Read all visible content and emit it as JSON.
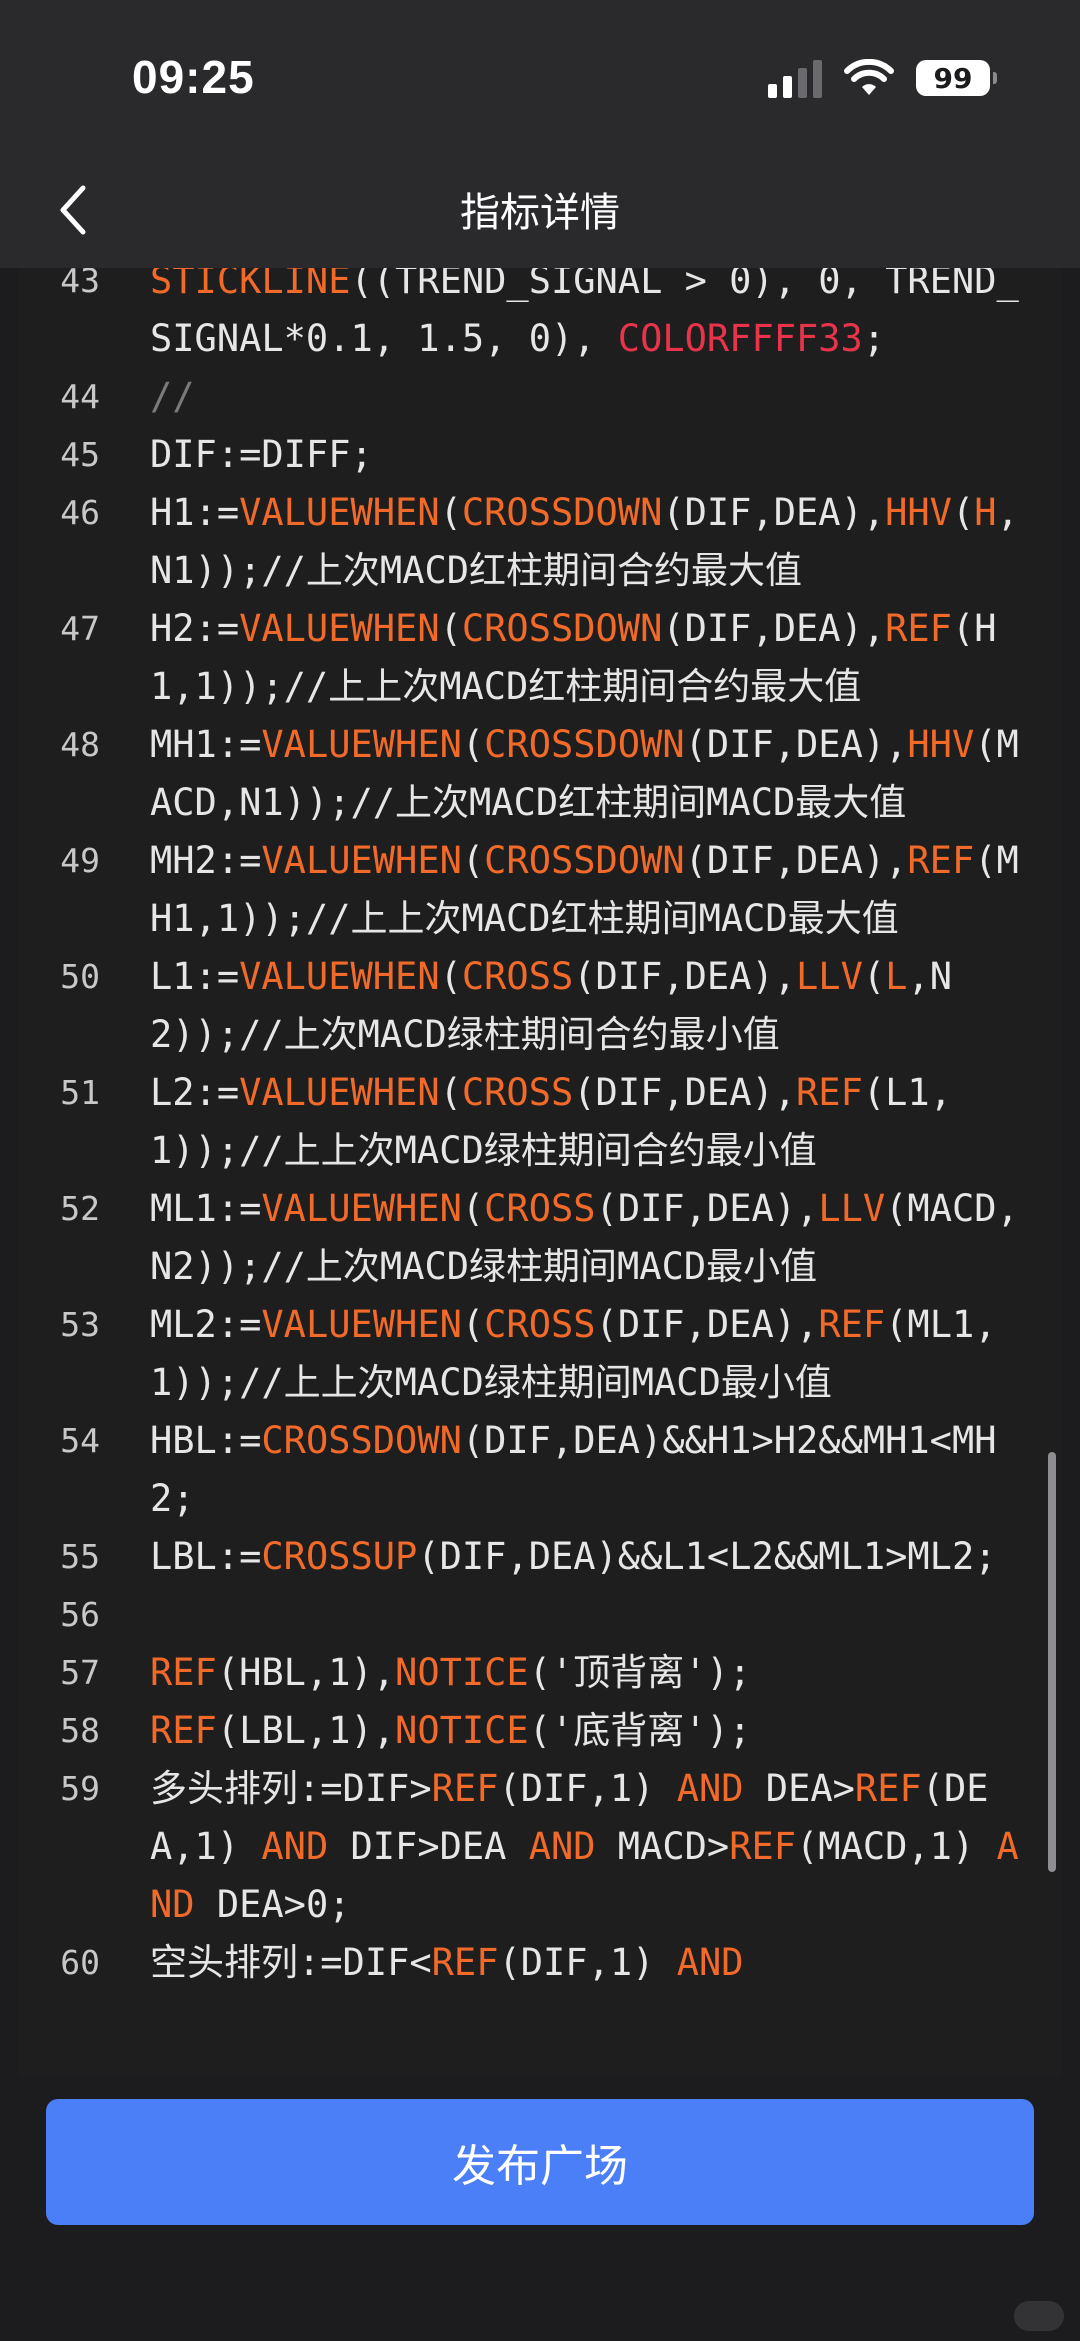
{
  "status_bar": {
    "time": "09:25",
    "battery": "99",
    "icons": [
      "signal-icon",
      "wifi-icon",
      "battery-icon"
    ]
  },
  "nav": {
    "title": "指标详情",
    "back_icon": "chevron-left-icon"
  },
  "code_lines": [
    {
      "number": "43",
      "tokens": [
        {
          "t": "fn",
          "v": "STICKLINE"
        },
        {
          "t": "plain",
          "v": "((TREND_SIGNAL > 0), 0, TREND_SIGNAL*0.1, 1.5, 0), "
        },
        {
          "t": "color",
          "v": "COLORFFFF33"
        },
        {
          "t": "plain",
          "v": ";"
        }
      ]
    },
    {
      "number": "44",
      "tokens": [
        {
          "t": "comment",
          "v": "//"
        }
      ]
    },
    {
      "number": "45",
      "tokens": [
        {
          "t": "plain",
          "v": "DIF:=DIFF;"
        }
      ]
    },
    {
      "number": "46",
      "tokens": [
        {
          "t": "plain",
          "v": "H1:="
        },
        {
          "t": "fn",
          "v": "VALUEWHEN"
        },
        {
          "t": "plain",
          "v": "("
        },
        {
          "t": "fn",
          "v": "CROSSDOWN"
        },
        {
          "t": "plain",
          "v": "(DIF,DEA),"
        },
        {
          "t": "fn",
          "v": "HHV"
        },
        {
          "t": "plain",
          "v": "("
        },
        {
          "t": "fn",
          "v": "H"
        },
        {
          "t": "plain",
          "v": ",N1));//上次MACD红柱期间合约最大值"
        }
      ]
    },
    {
      "number": "47",
      "tokens": [
        {
          "t": "plain",
          "v": "H2:="
        },
        {
          "t": "fn",
          "v": "VALUEWHEN"
        },
        {
          "t": "plain",
          "v": "("
        },
        {
          "t": "fn",
          "v": "CROSSDOWN"
        },
        {
          "t": "plain",
          "v": "(DIF,DEA),"
        },
        {
          "t": "fn",
          "v": "REF"
        },
        {
          "t": "plain",
          "v": "(H1,1));//上上次MACD红柱期间合约最大值"
        }
      ]
    },
    {
      "number": "48",
      "tokens": [
        {
          "t": "plain",
          "v": "MH1:="
        },
        {
          "t": "fn",
          "v": "VALUEWHEN"
        },
        {
          "t": "plain",
          "v": "("
        },
        {
          "t": "fn",
          "v": "CROSSDOWN"
        },
        {
          "t": "plain",
          "v": "(DIF,DEA),"
        },
        {
          "t": "fn",
          "v": "HHV"
        },
        {
          "t": "plain",
          "v": "(MACD,N1));//上次MACD红柱期间MACD最大值"
        }
      ]
    },
    {
      "number": "49",
      "tokens": [
        {
          "t": "plain",
          "v": "MH2:="
        },
        {
          "t": "fn",
          "v": "VALUEWHEN"
        },
        {
          "t": "plain",
          "v": "("
        },
        {
          "t": "fn",
          "v": "CROSSDOWN"
        },
        {
          "t": "plain",
          "v": "(DIF,DEA),"
        },
        {
          "t": "fn",
          "v": "REF"
        },
        {
          "t": "plain",
          "v": "(MH1,1));//上上次MACD红柱期间MACD最大值"
        }
      ]
    },
    {
      "number": "50",
      "tokens": [
        {
          "t": "plain",
          "v": "L1:="
        },
        {
          "t": "fn",
          "v": "VALUEWHEN"
        },
        {
          "t": "plain",
          "v": "("
        },
        {
          "t": "fn",
          "v": "CROSS"
        },
        {
          "t": "plain",
          "v": "(DIF,DEA),"
        },
        {
          "t": "fn",
          "v": "LLV"
        },
        {
          "t": "plain",
          "v": "("
        },
        {
          "t": "fn",
          "v": "L"
        },
        {
          "t": "plain",
          "v": ",N2));//上次MACD绿柱期间合约最小值"
        }
      ]
    },
    {
      "number": "51",
      "tokens": [
        {
          "t": "plain",
          "v": "L2:="
        },
        {
          "t": "fn",
          "v": "VALUEWHEN"
        },
        {
          "t": "plain",
          "v": "("
        },
        {
          "t": "fn",
          "v": "CROSS"
        },
        {
          "t": "plain",
          "v": "(DIF,DEA),"
        },
        {
          "t": "fn",
          "v": "REF"
        },
        {
          "t": "plain",
          "v": "(L1,1));//上上次MACD绿柱期间合约最小值"
        }
      ]
    },
    {
      "number": "52",
      "tokens": [
        {
          "t": "plain",
          "v": "ML1:="
        },
        {
          "t": "fn",
          "v": "VALUEWHEN"
        },
        {
          "t": "plain",
          "v": "("
        },
        {
          "t": "fn",
          "v": "CROSS"
        },
        {
          "t": "plain",
          "v": "(DIF,DEA),"
        },
        {
          "t": "fn",
          "v": "LLV"
        },
        {
          "t": "plain",
          "v": "(MACD,N2));//上次MACD绿柱期间MACD最小值"
        }
      ]
    },
    {
      "number": "53",
      "tokens": [
        {
          "t": "plain",
          "v": "ML2:="
        },
        {
          "t": "fn",
          "v": "VALUEWHEN"
        },
        {
          "t": "plain",
          "v": "("
        },
        {
          "t": "fn",
          "v": "CROSS"
        },
        {
          "t": "plain",
          "v": "(DIF,DEA),"
        },
        {
          "t": "fn",
          "v": "REF"
        },
        {
          "t": "plain",
          "v": "(ML1,1));//上上次MACD绿柱期间MACD最小值"
        }
      ]
    },
    {
      "number": "54",
      "tokens": [
        {
          "t": "plain",
          "v": "HBL:="
        },
        {
          "t": "fn",
          "v": "CROSSDOWN"
        },
        {
          "t": "plain",
          "v": "(DIF,DEA)&&H1>H2&&MH1<MH2;"
        }
      ]
    },
    {
      "number": "55",
      "tokens": [
        {
          "t": "plain",
          "v": "LBL:="
        },
        {
          "t": "fn",
          "v": "CROSSUP"
        },
        {
          "t": "plain",
          "v": "(DIF,DEA)&&L1<L2&&ML1>ML2;"
        }
      ]
    },
    {
      "number": "56",
      "tokens": []
    },
    {
      "number": "57",
      "tokens": [
        {
          "t": "fn",
          "v": "REF"
        },
        {
          "t": "plain",
          "v": "(HBL,1),"
        },
        {
          "t": "fn",
          "v": "NOTICE"
        },
        {
          "t": "plain",
          "v": "('顶背离');"
        }
      ]
    },
    {
      "number": "58",
      "tokens": [
        {
          "t": "fn",
          "v": "REF"
        },
        {
          "t": "plain",
          "v": "(LBL,1),"
        },
        {
          "t": "fn",
          "v": "NOTICE"
        },
        {
          "t": "plain",
          "v": "('底背离');"
        }
      ]
    },
    {
      "number": "59",
      "tokens": [
        {
          "t": "plain",
          "v": "多头排列:=DIF>"
        },
        {
          "t": "fn",
          "v": "REF"
        },
        {
          "t": "plain",
          "v": "(DIF,1) "
        },
        {
          "t": "fn",
          "v": "AND"
        },
        {
          "t": "plain",
          "v": " DEA>"
        },
        {
          "t": "fn",
          "v": "REF"
        },
        {
          "t": "plain",
          "v": "(DEA,1) "
        },
        {
          "t": "fn",
          "v": "AND"
        },
        {
          "t": "plain",
          "v": " DIF>DEA "
        },
        {
          "t": "fn",
          "v": "AND"
        },
        {
          "t": "plain",
          "v": " MACD>"
        },
        {
          "t": "fn",
          "v": "REF"
        },
        {
          "t": "plain",
          "v": "(MACD,1) "
        },
        {
          "t": "fn",
          "v": "AND"
        },
        {
          "t": "plain",
          "v": " DEA>0;"
        }
      ]
    },
    {
      "number": "60",
      "tokens": [
        {
          "t": "plain",
          "v": "空头排列:=DIF<"
        },
        {
          "t": "fn",
          "v": "REF"
        },
        {
          "t": "plain",
          "v": "(DIF,1) "
        },
        {
          "t": "fn",
          "v": "AND"
        }
      ]
    }
  ],
  "footer": {
    "publish_label": "发布广场"
  }
}
